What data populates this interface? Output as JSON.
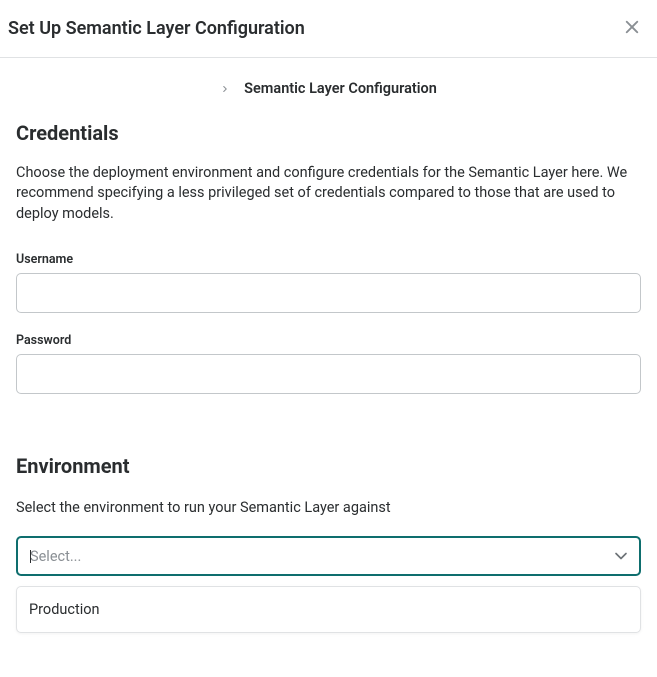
{
  "header": {
    "title": "Set Up Semantic Layer Configuration"
  },
  "breadcrumb": {
    "current": "Semantic Layer Configuration"
  },
  "credentials": {
    "title": "Credentials",
    "help": "Choose the deployment environment and configure credentials for the Semantic Layer here. We recommend specifying a less privileged set of credentials compared to those that are used to deploy models.",
    "usernameLabel": "Username",
    "usernameValue": "",
    "passwordLabel": "Password",
    "passwordValue": ""
  },
  "environment": {
    "title": "Environment",
    "help": "Select the environment to run your Semantic Layer against",
    "selectPlaceholder": "Select...",
    "options": [
      "Production"
    ]
  }
}
